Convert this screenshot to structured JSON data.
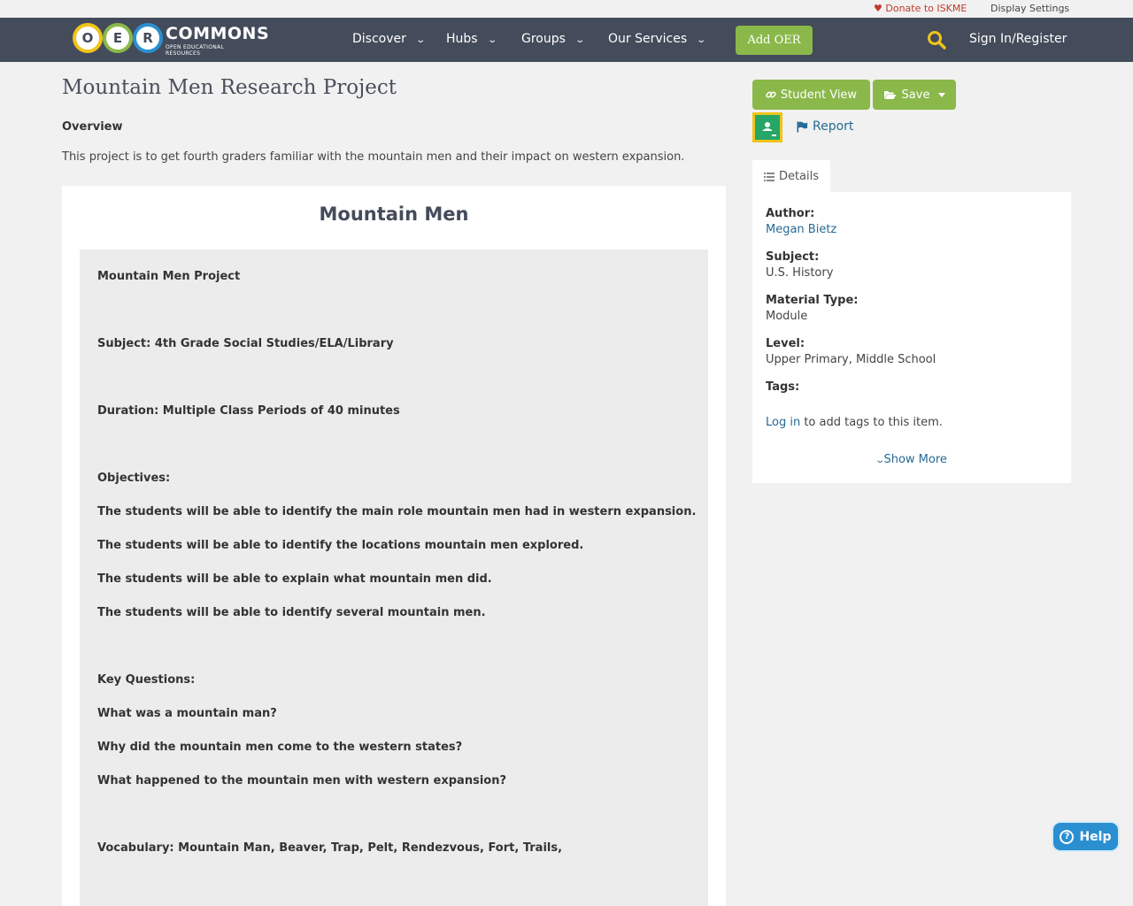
{
  "topbar": {
    "donate": "Donate to ISKME",
    "display_settings": "Display Settings"
  },
  "logo": {
    "letters": [
      "O",
      "E",
      "R"
    ],
    "word": "COMMONS",
    "subtitle": "OPEN EDUCATIONAL RESOURCES"
  },
  "nav": {
    "items": [
      "Discover",
      "Hubs",
      "Groups",
      "Our Services"
    ],
    "add_oer": "Add OER",
    "sign_in": "Sign In/Register"
  },
  "page": {
    "title": "Mountain Men Research Project",
    "overview_label": "Overview",
    "overview_text": "This project is to get fourth graders familiar with the mountain men and their impact on western expansion."
  },
  "content": {
    "heading": "Mountain Men",
    "lines": [
      "Mountain Men Project",
      "Subject: 4th Grade Social Studies/ELA/Library",
      "Duration: Multiple Class Periods of 40 minutes",
      "Objectives:",
      "The students will be able to identify the main role mountain men had in western expansion.",
      "The students will be able to identify the locations mountain men explored.",
      "The students will be able to explain what mountain men did.",
      "The students will be able to identify several mountain men.",
      "Key Questions:",
      "What was a mountain man?",
      "Why did the mountain men come to the western states?",
      "What happened to the mountain men with western expansion?",
      "Vocabulary: Mountain Man, Beaver, Trap, Pelt, Rendezvous, Fort, Trails,"
    ]
  },
  "actions": {
    "student_view": "Student View",
    "save": "Save",
    "report": "Report"
  },
  "details": {
    "tab_label": "Details",
    "author_label": "Author:",
    "author": "Megan Bietz",
    "subject_label": "Subject:",
    "subject": "U.S. History",
    "material_label": "Material Type:",
    "material": "Module",
    "level_label": "Level:",
    "level": "Upper Primary, Middle School",
    "tags_label": "Tags:",
    "login_link": "Log in",
    "login_rest": " to add tags to this item.",
    "show_more": "Show More"
  },
  "help": {
    "label": "Help"
  },
  "colors": {
    "navbar": "#444b5a",
    "accent_green": "#8ab84a",
    "link_blue": "#256b96",
    "search_yellow": "#f0c419",
    "help_blue": "#2a8fd1"
  },
  "icons": [
    "heart-icon",
    "chevron-down-icon",
    "search-icon",
    "link-icon",
    "folder-open-icon",
    "caret-down-icon",
    "google-classroom-icon",
    "flag-icon",
    "list-icon",
    "help-circle-icon"
  ]
}
